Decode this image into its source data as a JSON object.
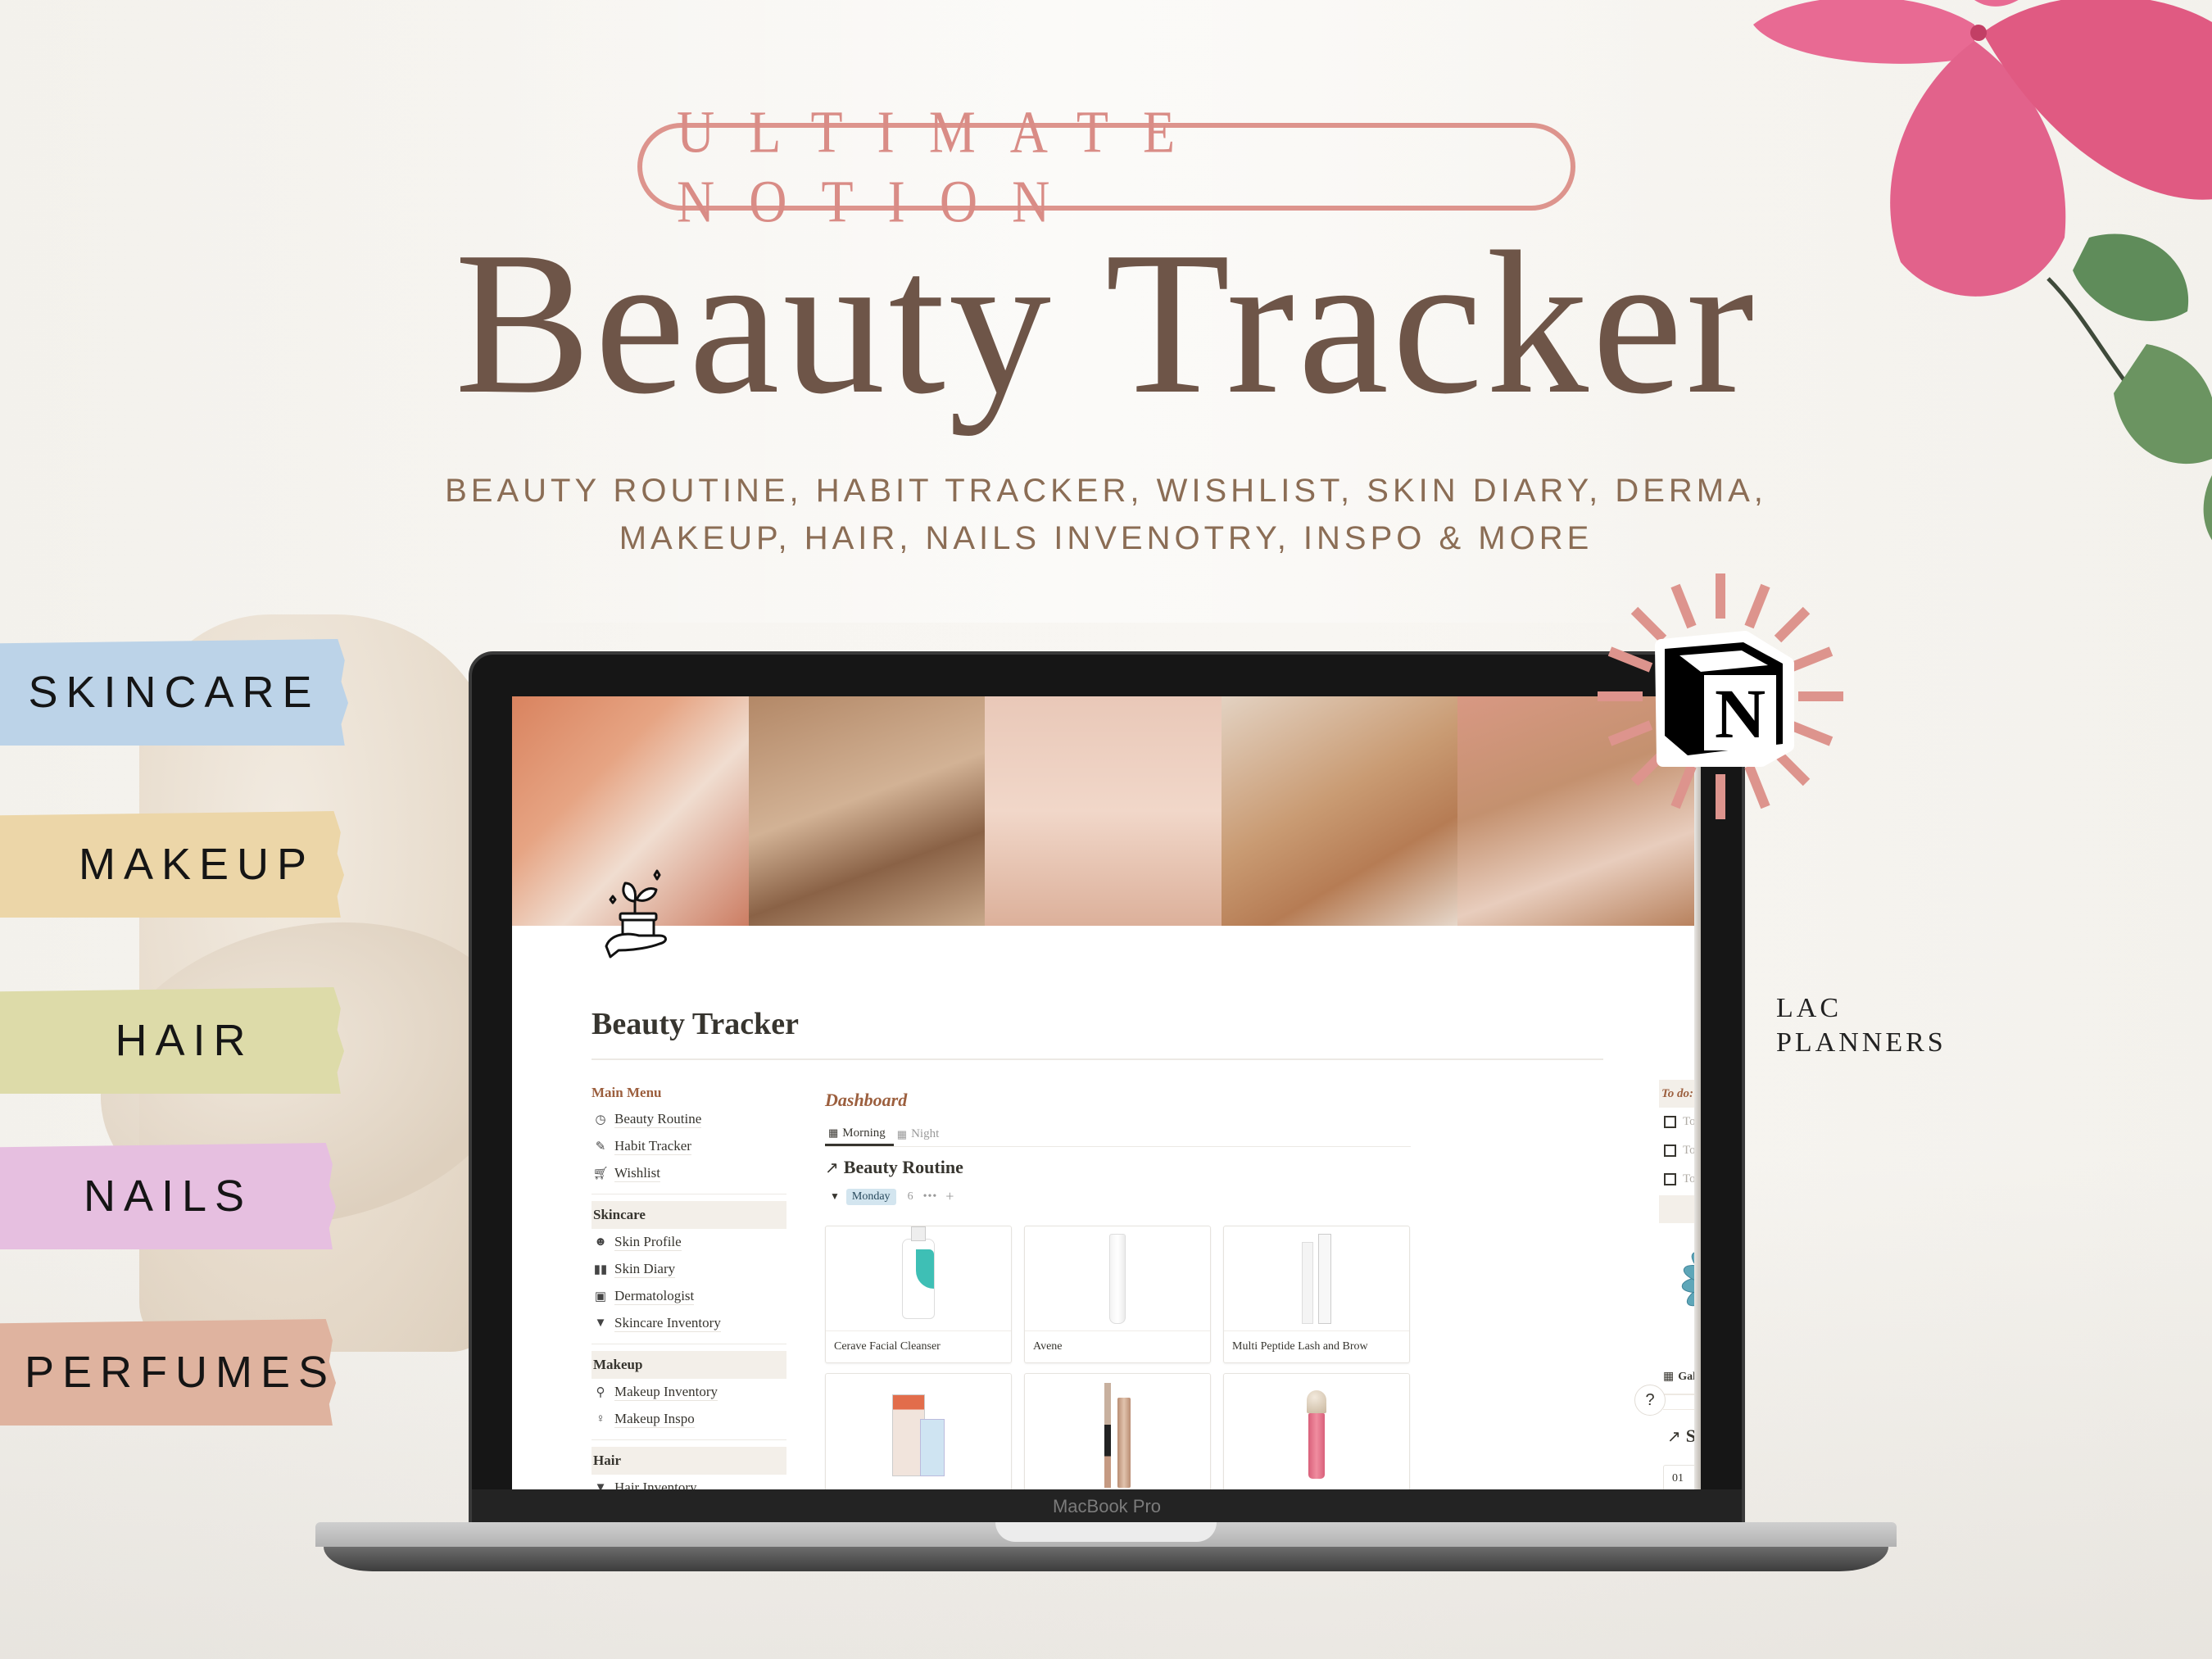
{
  "header": {
    "eyebrow": "ULTIMATE NOTION",
    "title": "Beauty Tracker",
    "subtitle_line1": "BEAUTY ROUTINE, HABIT TRACKER, WISHLIST, SKIN DIARY, DERMA,",
    "subtitle_line2": "MAKEUP, HAIR, NAILS INVENOTRY, INSPO & MORE"
  },
  "categories": [
    {
      "label": "SKINCARE",
      "color": "#bcd3e8"
    },
    {
      "label": "MAKEUP",
      "color": "#ecd6a8"
    },
    {
      "label": "HAIR",
      "color": "#dddba9"
    },
    {
      "label": "NAILS",
      "color": "#e6bfe0"
    },
    {
      "label": "PERFUMES",
      "color": "#dfb39f"
    }
  ],
  "brand": {
    "line1": "LAC",
    "line2": "PLANNERS"
  },
  "laptop": {
    "model_label": "MacBook Pro"
  },
  "badge": {
    "logo_letter": "N",
    "icon": "notion-logo-icon"
  },
  "notion": {
    "page_title": "Beauty Tracker",
    "page_icon": "hand-holding-plant-jar-icon",
    "sidebar": {
      "main_menu_label": "Main Menu",
      "main_items": [
        {
          "icon": "clock-icon",
          "label": "Beauty Routine"
        },
        {
          "icon": "edit-icon",
          "label": "Habit Tracker"
        },
        {
          "icon": "cart-icon",
          "label": "Wishlist"
        }
      ],
      "sections": [
        {
          "label": "Skincare",
          "items": [
            {
              "icon": "smiley-icon",
              "label": "Skin Profile"
            },
            {
              "icon": "book-icon",
              "label": "Skin Diary"
            },
            {
              "icon": "calendar-icon",
              "label": "Dermatologist"
            },
            {
              "icon": "cup-icon",
              "label": "Skincare Inventory"
            }
          ]
        },
        {
          "label": "Makeup",
          "items": [
            {
              "icon": "makeup-brush-icon",
              "label": "Makeup Inventory"
            },
            {
              "icon": "mirror-icon",
              "label": "Makeup Inspo"
            }
          ]
        },
        {
          "label": "Hair",
          "items": [
            {
              "icon": "cup-icon",
              "label": "Hair Inventory"
            }
          ]
        }
      ]
    },
    "dashboard": {
      "title": "Dashboard",
      "tabs": [
        {
          "label": "Morning",
          "active": true
        },
        {
          "label": "Night",
          "active": false
        }
      ],
      "routine_title": "Beauty Routine",
      "group": {
        "label": "Monday",
        "count": "6",
        "more": "•••",
        "add": "+"
      },
      "cards": [
        {
          "name": "Cerave Facial Cleanser",
          "kind": "bottle"
        },
        {
          "name": "Avene",
          "kind": "tube"
        },
        {
          "name": "Multi Peptide Lash and Brow",
          "kind": "serum"
        },
        {
          "name": "",
          "kind": "sunscreen"
        },
        {
          "name": "",
          "kind": "mascara"
        },
        {
          "name": "",
          "kind": "blush"
        }
      ]
    },
    "right_column": {
      "todo_header": "To do:",
      "todos": [
        {
          "label": "To-do",
          "checked": false
        },
        {
          "label": "To-do",
          "checked": false
        },
        {
          "label": "To-do",
          "checked": false
        }
      ],
      "gallery_view_label": "Gallery",
      "diary_title": "Skincare Diary",
      "diary_first_entry": "01"
    },
    "help_label": "?"
  },
  "colors": {
    "accent_rose": "#dd948d",
    "title_brown": "#6e5548",
    "notion_accent": "#9c5f3e",
    "flower_pink": "#e0557f",
    "leaf_green": "#5f8c5a"
  }
}
